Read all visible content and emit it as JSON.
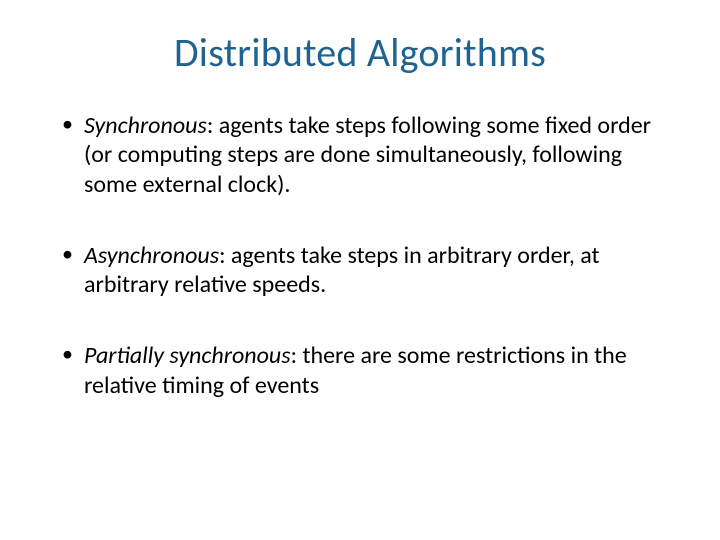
{
  "slide": {
    "title": "Distributed Algorithms",
    "bullets": [
      {
        "term": "Synchronous",
        "desc": ": agents take steps following some fixed order (or computing steps are done simultaneously, following some external clock)."
      },
      {
        "term": "Asynchronous",
        "desc": ": agents take steps in arbitrary order, at arbitrary relative speeds."
      },
      {
        "term": "Partially synchronous",
        "desc": ": there are some restrictions in the relative timing of events"
      }
    ]
  }
}
